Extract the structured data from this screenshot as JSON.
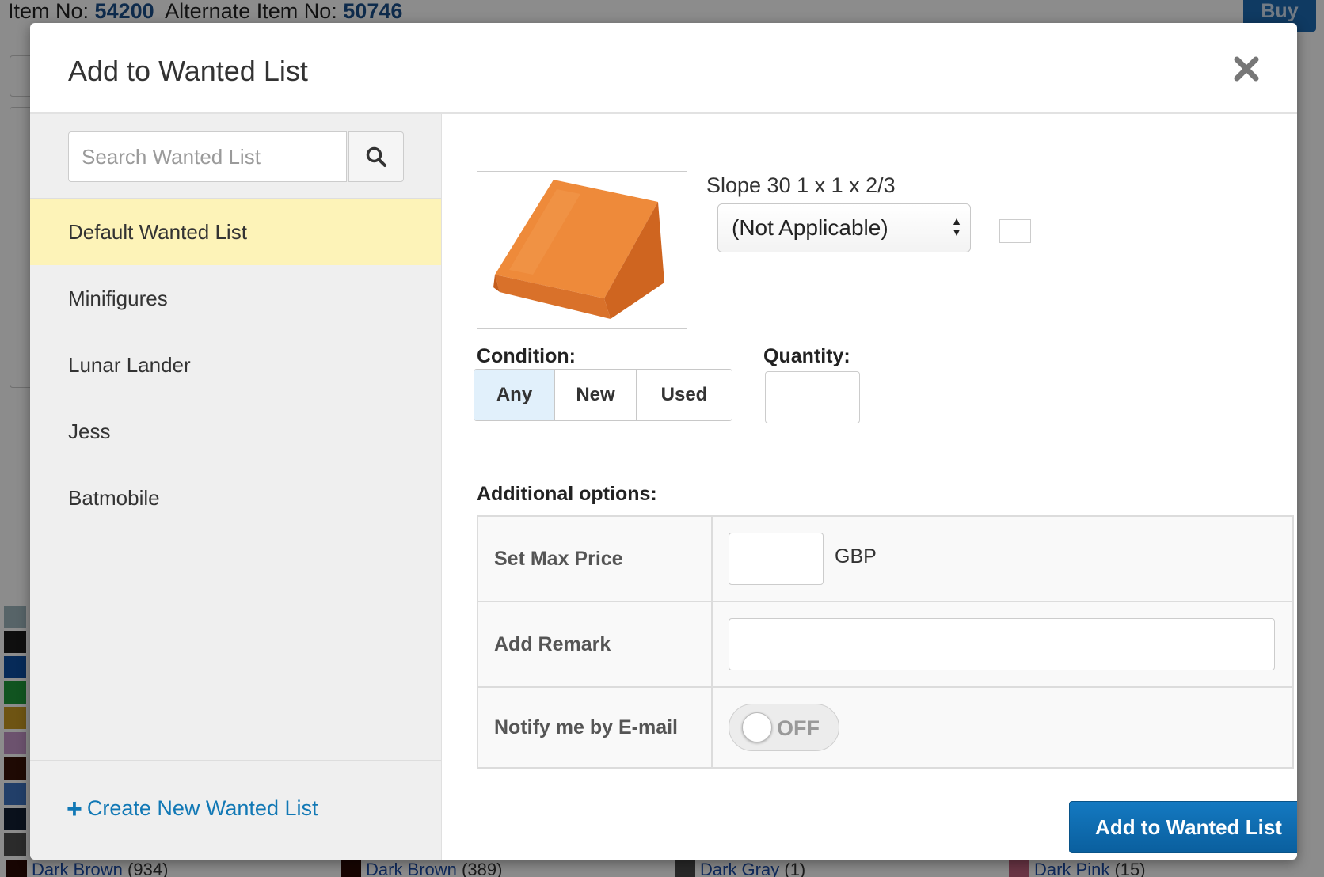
{
  "background": {
    "item_no_label": "Item No:",
    "item_no": "54200",
    "alt_item_no_label": "Alternate Item No:",
    "alt_item_no": "50746",
    "buy_label": "Buy",
    "bottom_colors": [
      {
        "name": "Dark Brown",
        "count": "(934)",
        "swatch": "#2a0a05"
      },
      {
        "name": "Dark Brown",
        "count": "(389)",
        "swatch": "#2a0a05"
      },
      {
        "name": "Dark Gray",
        "count": "(1)",
        "swatch": "#4a4a4a"
      },
      {
        "name": "Dark Pink",
        "count": "(15)",
        "swatch": "#c2627e"
      }
    ],
    "side_swatches": [
      "#9fb7bd",
      "#1c1c1c",
      "#0b4ea1",
      "#1f9a3b",
      "#c99a23",
      "#c595c8",
      "#3a1308",
      "#3e74c0",
      "#132033",
      "#4f4f4f"
    ]
  },
  "modal": {
    "title": "Add to Wanted List",
    "close_icon": "close-icon"
  },
  "sidebar": {
    "search_placeholder": "Search Wanted List",
    "search_icon": "search-icon",
    "lists": [
      {
        "label": "Default Wanted List",
        "active": true
      },
      {
        "label": "Minifigures",
        "active": false
      },
      {
        "label": "Lunar Lander",
        "active": false
      },
      {
        "label": "Jess",
        "active": false
      },
      {
        "label": "Batmobile",
        "active": false
      }
    ],
    "create_label": "Create New Wanted List",
    "create_icon": "plus-icon"
  },
  "item": {
    "name": "Slope 30 1 x 1 x 2/3",
    "color_selected": "(Not Applicable)",
    "part_color": "#e0762a"
  },
  "condition": {
    "label": "Condition:",
    "options": [
      "Any",
      "New",
      "Used"
    ],
    "selected": "Any"
  },
  "quantity": {
    "label": "Quantity:",
    "value": ""
  },
  "additional": {
    "label": "Additional options:",
    "max_price_label": "Set Max Price",
    "max_price_value": "",
    "currency": "GBP",
    "remark_label": "Add Remark",
    "remark_value": "",
    "notify_label": "Notify me by E-mail",
    "notify_state": "OFF"
  },
  "submit_label": "Add to Wanted List",
  "colors": {
    "accent": "#1178b5",
    "active_list_bg": "#fdf3b8",
    "active_condition_bg": "#e1f0fb",
    "submit_bg": "#0e6aaf"
  }
}
